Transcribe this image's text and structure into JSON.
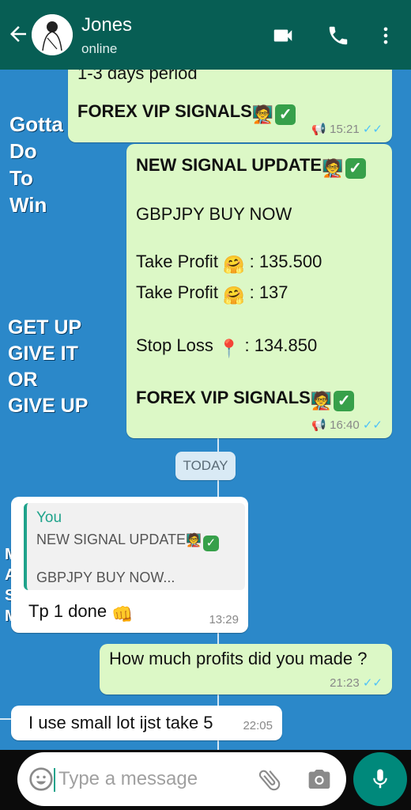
{
  "header": {
    "title": "Jones",
    "status": "online"
  },
  "wall": {
    "text1": [
      "Gotta",
      "Do",
      "To",
      "Win"
    ],
    "text2": [
      "GET UP",
      "GIVE IT",
      "OR",
      "GIVE UP"
    ],
    "text3": [
      "M",
      "A",
      "S",
      "M"
    ]
  },
  "messages": {
    "m1": {
      "line1": "1-3 days period",
      "line2": "FOREX VIP SIGNALS",
      "time": "15:21",
      "ticks": "✓✓"
    },
    "m2": {
      "line1": "NEW SIGNAL UPDATE",
      "line2": "GBPJPY BUY NOW",
      "line3a": "Take Profit",
      "line3b": ": 135.500",
      "line4a": "Take Profit",
      "line4b": ": 137",
      "line5a": "Stop Loss",
      "line5b": ": 134.850",
      "line6": "FOREX VIP SIGNALS",
      "time": "16:40",
      "ticks": "✓✓"
    },
    "date_divider": "TODAY",
    "m3": {
      "quote_author": "You",
      "quote_line1": "NEW SIGNAL UPDATE",
      "quote_line2": "GBPJPY BUY NOW...",
      "text": "Tp 1 done",
      "time": "13:29"
    },
    "m4": {
      "text": "How much profits did you made ?",
      "time": "21:23",
      "ticks": "✓✓"
    },
    "m5": {
      "text": "I use small lot ijst take 5",
      "time": "22:05"
    }
  },
  "composer": {
    "placeholder": "Type a message"
  },
  "icons": {
    "back": "arrow-left-icon",
    "video": "video-call-icon",
    "phone": "phone-icon",
    "menu": "more-vertical-icon",
    "emoji": "emoji-icon",
    "attach": "paperclip-icon",
    "camera": "camera-icon",
    "mic": "microphone-icon"
  },
  "colors": {
    "header": "#075e54",
    "outgoing_bubble": "#dcf8c6",
    "incoming_bubble": "#ffffff",
    "read_ticks": "#4fc3f7",
    "mic_button": "#00897b"
  }
}
